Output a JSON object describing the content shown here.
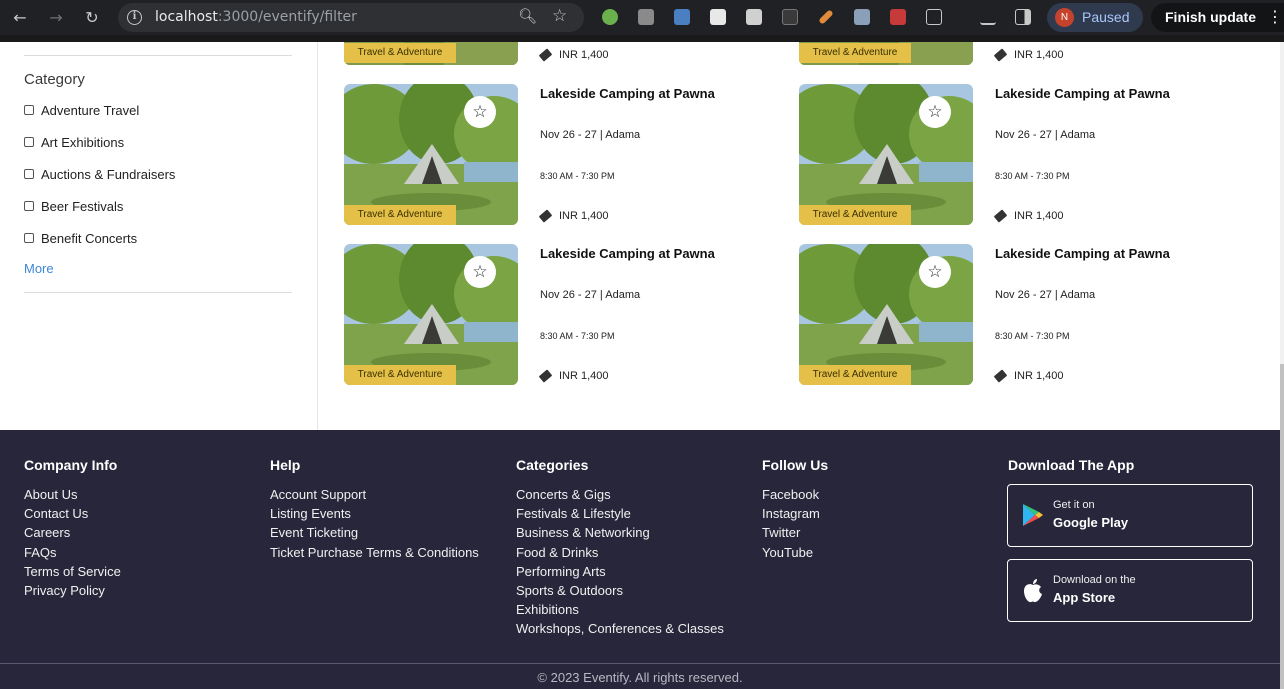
{
  "browser": {
    "url_host": "localhost",
    "url_path": ":3000/eventify/filter",
    "profile_initial": "N",
    "profile_status": "Paused",
    "finish_update": "Finish update"
  },
  "sidebar": {
    "title": "Category",
    "items": [
      {
        "label": "Adventure Travel"
      },
      {
        "label": "Art Exhibitions"
      },
      {
        "label": "Auctions & Fundraisers"
      },
      {
        "label": "Beer Festivals"
      },
      {
        "label": "Benefit Concerts"
      }
    ],
    "more": "More"
  },
  "partial_cards": [
    {
      "tag": "Travel & Adventure",
      "price": "INR 1,400"
    },
    {
      "tag": "Travel & Adventure",
      "price": "INR 1,400"
    }
  ],
  "events": [
    {
      "title": "Lakeside Camping at Pawna",
      "date": "Nov 26 - 27",
      "location": "Adama",
      "time": "8:30 AM - 7:30 PM",
      "price": "INR 1,400",
      "tag": "Travel & Adventure"
    },
    {
      "title": "Lakeside Camping at Pawna",
      "date": "Nov 26 - 27",
      "location": "Adama",
      "time": "8:30 AM - 7:30 PM",
      "price": "INR 1,400",
      "tag": "Travel & Adventure"
    },
    {
      "title": "Lakeside Camping at Pawna",
      "date": "Nov 26 - 27",
      "location": "Adama",
      "time": "8:30 AM - 7:30 PM",
      "price": "INR 1,400",
      "tag": "Travel & Adventure"
    },
    {
      "title": "Lakeside Camping at Pawna",
      "date": "Nov 26 - 27",
      "location": "Adama",
      "time": "8:30 AM - 7:30 PM",
      "price": "INR 1,400",
      "tag": "Travel & Adventure"
    }
  ],
  "footer": {
    "company": {
      "heading": "Company Info",
      "links": [
        "About Us",
        "Contact Us",
        "Careers",
        "FAQs",
        "Terms of Service",
        "Privacy Policy"
      ]
    },
    "help": {
      "heading": "Help",
      "links": [
        "Account Support",
        "Listing Events",
        "Event Ticketing",
        "Ticket Purchase Terms & Conditions"
      ]
    },
    "categories": {
      "heading": "Categories",
      "links": [
        "Concerts & Gigs",
        "Festivals & Lifestyle",
        "Business & Networking",
        "Food & Drinks",
        "Performing Arts",
        "Sports & Outdoors",
        "Exhibitions",
        "Workshops, Conferences & Classes"
      ]
    },
    "follow": {
      "heading": "Follow Us",
      "links": [
        "Facebook",
        "Instagram",
        "Twitter",
        "YouTube"
      ]
    },
    "app": {
      "heading": "Download The App",
      "google_small": "Get it on",
      "google_big": "Google Play",
      "apple_small": "Download on the",
      "apple_big": "App Store"
    },
    "copyright": "© 2023 Eventify. All rights reserved."
  },
  "colors": {
    "footer_bg": "#27263a",
    "tag_bg": "#e4c048",
    "link_blue": "#3f87d6"
  }
}
